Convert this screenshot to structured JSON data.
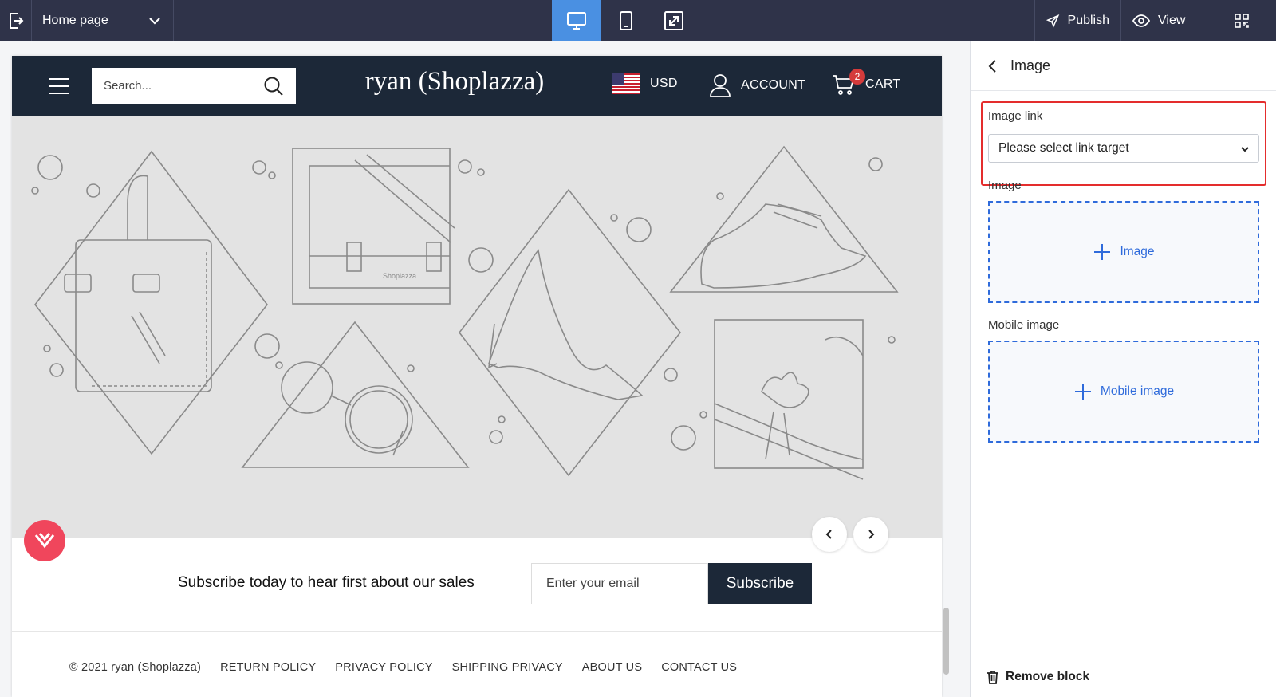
{
  "toolbar": {
    "page_selector": "Home page",
    "publish_label": "Publish",
    "view_label": "View",
    "devices": [
      "desktop",
      "tablet",
      "fullscreen"
    ],
    "active_device": "desktop",
    "accent_color": "#4a90e2",
    "bg_color": "#2f3349"
  },
  "store": {
    "search_placeholder": "Search...",
    "title": "ryan (Shoplazza)",
    "currency": "USD",
    "account_label": "ACCOUNT",
    "cart_label": "CART",
    "cart_count": "2",
    "banner_brand_text": "Shoplazza",
    "subscribe_text": "Subscribe today to hear first about our sales",
    "email_placeholder": "Enter your email",
    "subscribe_button": "Subscribe",
    "footer_links": [
      "© 2021 ryan (Shoplazza)",
      "RETURN POLICY",
      "PRIVACY POLICY",
      "SHIPPING PRIVACY",
      "ABOUT US",
      "CONTACT US"
    ],
    "header_color": "#1c2838"
  },
  "panel": {
    "title": "Image",
    "image_link_label": "Image link",
    "link_select_value": "Please select link target",
    "image_label": "Image",
    "image_upload_label": "Image",
    "mobile_image_label": "Mobile image",
    "mobile_upload_label": "Mobile image",
    "remove_block_label": "Remove block",
    "highlight_color": "#e42d2d",
    "upload_color": "#2f6bdb"
  }
}
